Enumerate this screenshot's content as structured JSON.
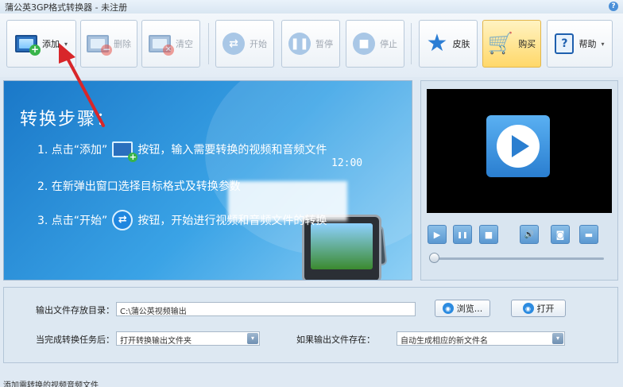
{
  "window": {
    "title": "蒲公英3GP格式转换器 - 未注册",
    "help_mark": "?"
  },
  "toolbar": {
    "add_label": "添加",
    "delete_label": "删除",
    "clear_label": "清空",
    "start_label": "开始",
    "pause_label": "暂停",
    "stop_label": "停止",
    "skin_label": "皮肤",
    "buy_label": "购买",
    "help_label": "帮助",
    "dropdown_caret": "▾",
    "icons": {
      "add": "add-video-icon",
      "delete": "delete-video-icon",
      "clear": "clear-video-icon",
      "start": "shuffle-start-icon",
      "pause": "pause-icon",
      "stop": "stop-icon",
      "skin": "star-icon",
      "buy": "cart-icon",
      "help": "help-icon"
    },
    "buy_color": "#ffd86a"
  },
  "guide": {
    "heading": "转换步骤：",
    "step1_pre": "1. 点击“添加”",
    "step1_post": "按钮，输入需要转换的视频和音频文件",
    "step2": "2. 在新弹出窗口选择目标格式及转换参数",
    "step3_pre": "3. 点击“开始”",
    "step3_post": "按钮，开始进行视频和音频文件的转换",
    "clock": "12:00",
    "accent": "#1a78c8"
  },
  "preview": {
    "controls": {
      "play": "play-icon",
      "pause": "pause-icon",
      "stop": "stop-icon",
      "volume": "volume-icon",
      "snapshot": "camera-icon",
      "fullscreen": "fullscreen-icon"
    },
    "glyph_play": "▶",
    "glyph_pause": "❚❚",
    "glyph_stop": "■",
    "glyph_volume": "🔊",
    "glyph_camera": "◙",
    "glyph_full": "▬",
    "position": 0
  },
  "settings": {
    "output_dir_label": "输出文件存放目录：",
    "output_dir_value": "C:\\蒲公英视频输出",
    "browse_label": "浏览...",
    "open_label": "打开",
    "after_done_label": "当完成转换任务后：",
    "after_done_value": "打开转换输出文件夹",
    "if_exists_label": "如果输出文件存在：",
    "if_exists_value": "自动生成相应的新文件名",
    "select_arrow": "▾"
  },
  "status": {
    "text": "添加需转换的视频音频文件"
  }
}
